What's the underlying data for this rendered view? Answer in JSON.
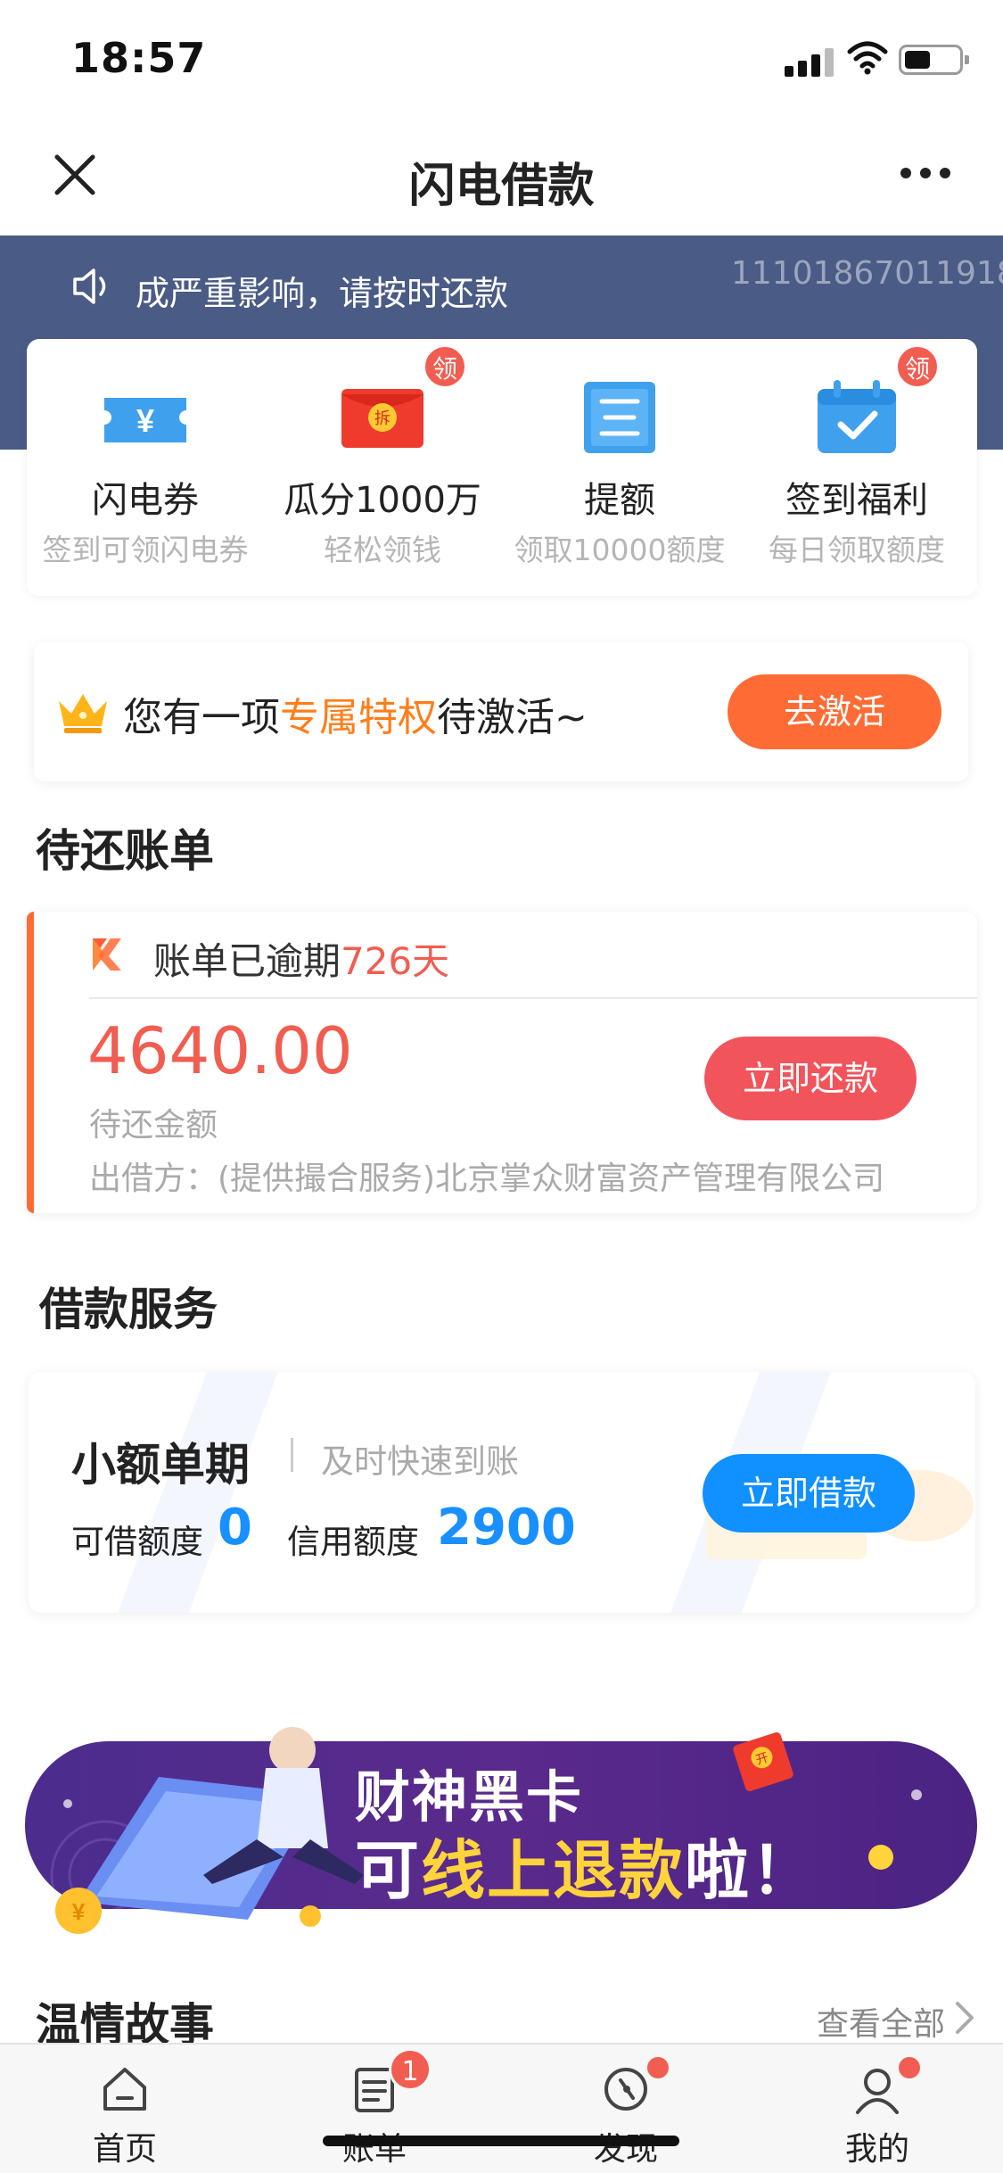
{
  "status_bar": {
    "time": "18:57"
  },
  "nav": {
    "title": "闪电借款"
  },
  "notice": {
    "text": "成严重影响，请按时还款",
    "id": "11101867011918"
  },
  "quick_actions": [
    {
      "title": "闪电券",
      "subtitle": "签到可领闪电券",
      "icon": "ticket-icon"
    },
    {
      "title": "瓜分1000万",
      "subtitle": "轻松领钱",
      "icon": "red-envelope-icon",
      "badge": "领",
      "envelope_text": "拆"
    },
    {
      "title": "提额",
      "subtitle": "领取10000额度",
      "icon": "list-icon"
    },
    {
      "title": "签到福利",
      "subtitle": "每日领取额度",
      "icon": "calendar-check-icon",
      "badge": "领"
    }
  ],
  "privilege": {
    "text_before": "您有一项",
    "highlight": "专属特权",
    "text_after": "待激活~",
    "button": "去激活"
  },
  "bills": {
    "title": "待还账单",
    "status_prefix": "账单已逾期",
    "overdue_days": "726天",
    "amount": "4640.00",
    "amount_label": "待还金额",
    "lender": "出借方：(提供撮合服务)北京掌众财富资产管理有限公司",
    "button": "立即还款"
  },
  "loan": {
    "title": "借款服务",
    "product": "小额单期",
    "desc": "及时快速到账",
    "available_label": "可借额度",
    "available_value": "0",
    "credit_label": "信用额度",
    "credit_value": "2900",
    "button": "立即借款"
  },
  "promo": {
    "line1": "财神黑卡",
    "line2_a": "可",
    "line2_b": "线上退款",
    "line2_c": "啦！",
    "envelope_text": "开"
  },
  "stories": {
    "title": "温情故事",
    "view_all": "查看全部"
  },
  "tabs": [
    {
      "label": "首页",
      "icon": "home-icon"
    },
    {
      "label": "账单",
      "icon": "bill-icon",
      "badge": "1"
    },
    {
      "label": "发现",
      "icon": "compass-icon",
      "dot": true
    },
    {
      "label": "我的",
      "icon": "user-icon",
      "dot": true
    }
  ],
  "colors": {
    "accent_orange": "#ff6b35",
    "accent_red": "#f15d50",
    "accent_blue": "#1890ff",
    "banner_blue": "#4a5b85"
  }
}
